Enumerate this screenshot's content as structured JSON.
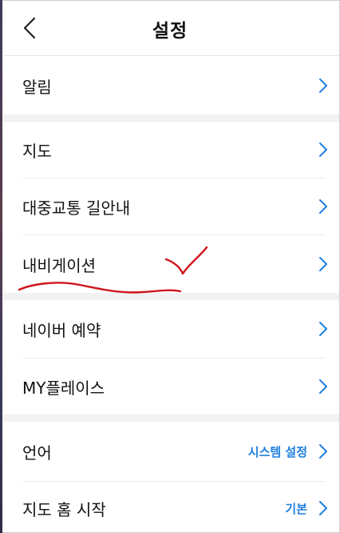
{
  "header": {
    "title": "설정"
  },
  "groups": [
    {
      "items": [
        {
          "label": "알림",
          "value": ""
        }
      ]
    },
    {
      "items": [
        {
          "label": "지도",
          "value": ""
        },
        {
          "label": "대중교통 길안내",
          "value": ""
        },
        {
          "label": "내비게이션",
          "value": ""
        }
      ]
    },
    {
      "items": [
        {
          "label": "네이버 예약",
          "value": ""
        },
        {
          "label": "MY플레이스",
          "value": ""
        }
      ]
    },
    {
      "items": [
        {
          "label": "언어",
          "value": "시스템 설정"
        },
        {
          "label": "지도 홈 시작",
          "value": "기본"
        }
      ]
    }
  ],
  "colors": {
    "accent": "#1e7fe0",
    "annotation_ink": "#d0141c",
    "section_gap": "#f2f2f2"
  }
}
